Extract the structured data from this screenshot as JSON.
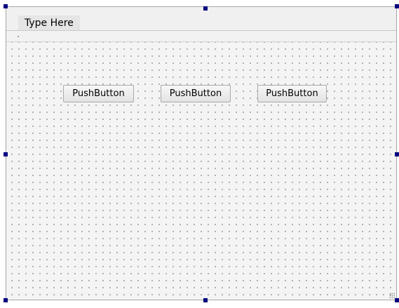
{
  "menubar": {
    "type_here_label": "Type Here"
  },
  "buttons": [
    {
      "label": "PushButton"
    },
    {
      "label": "PushButton"
    },
    {
      "label": "PushButton"
    }
  ],
  "colors": {
    "selection_handle": "#00007f",
    "canvas_background": "#f4f4f4",
    "grid_dot": "#9b9b9b"
  }
}
